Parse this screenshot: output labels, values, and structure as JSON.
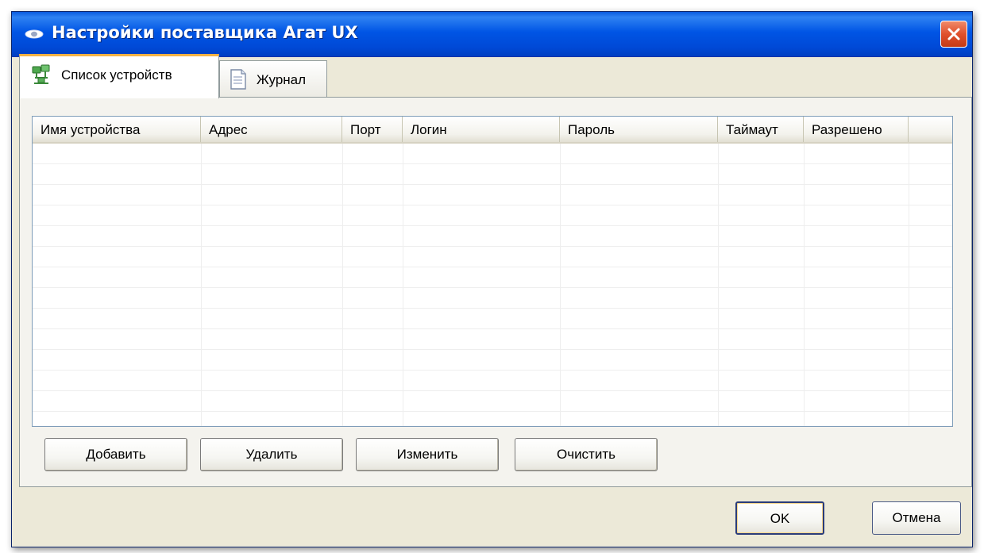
{
  "window": {
    "title": "Настройки поставщика Агат UX",
    "accent": "#0055e5",
    "close_color": "#e0502c",
    "icons": {
      "title": "eye-icon",
      "close": "close-icon"
    }
  },
  "tabs": [
    {
      "label": "Список устройств",
      "icon": "network-devices-icon",
      "active": true
    },
    {
      "label": "Журнал",
      "icon": "document-icon",
      "active": false
    }
  ],
  "device_list": {
    "columns": [
      "Имя устройства",
      "Адрес",
      "Порт",
      "Логин",
      "Пароль",
      "Таймаут",
      "Разрешено"
    ],
    "rows": []
  },
  "actions": {
    "add": "Добавить",
    "delete": "Удалить",
    "edit": "Изменить",
    "clear": "Очистить"
  },
  "dialog_buttons": {
    "ok": "OK",
    "cancel": "Отмена"
  }
}
